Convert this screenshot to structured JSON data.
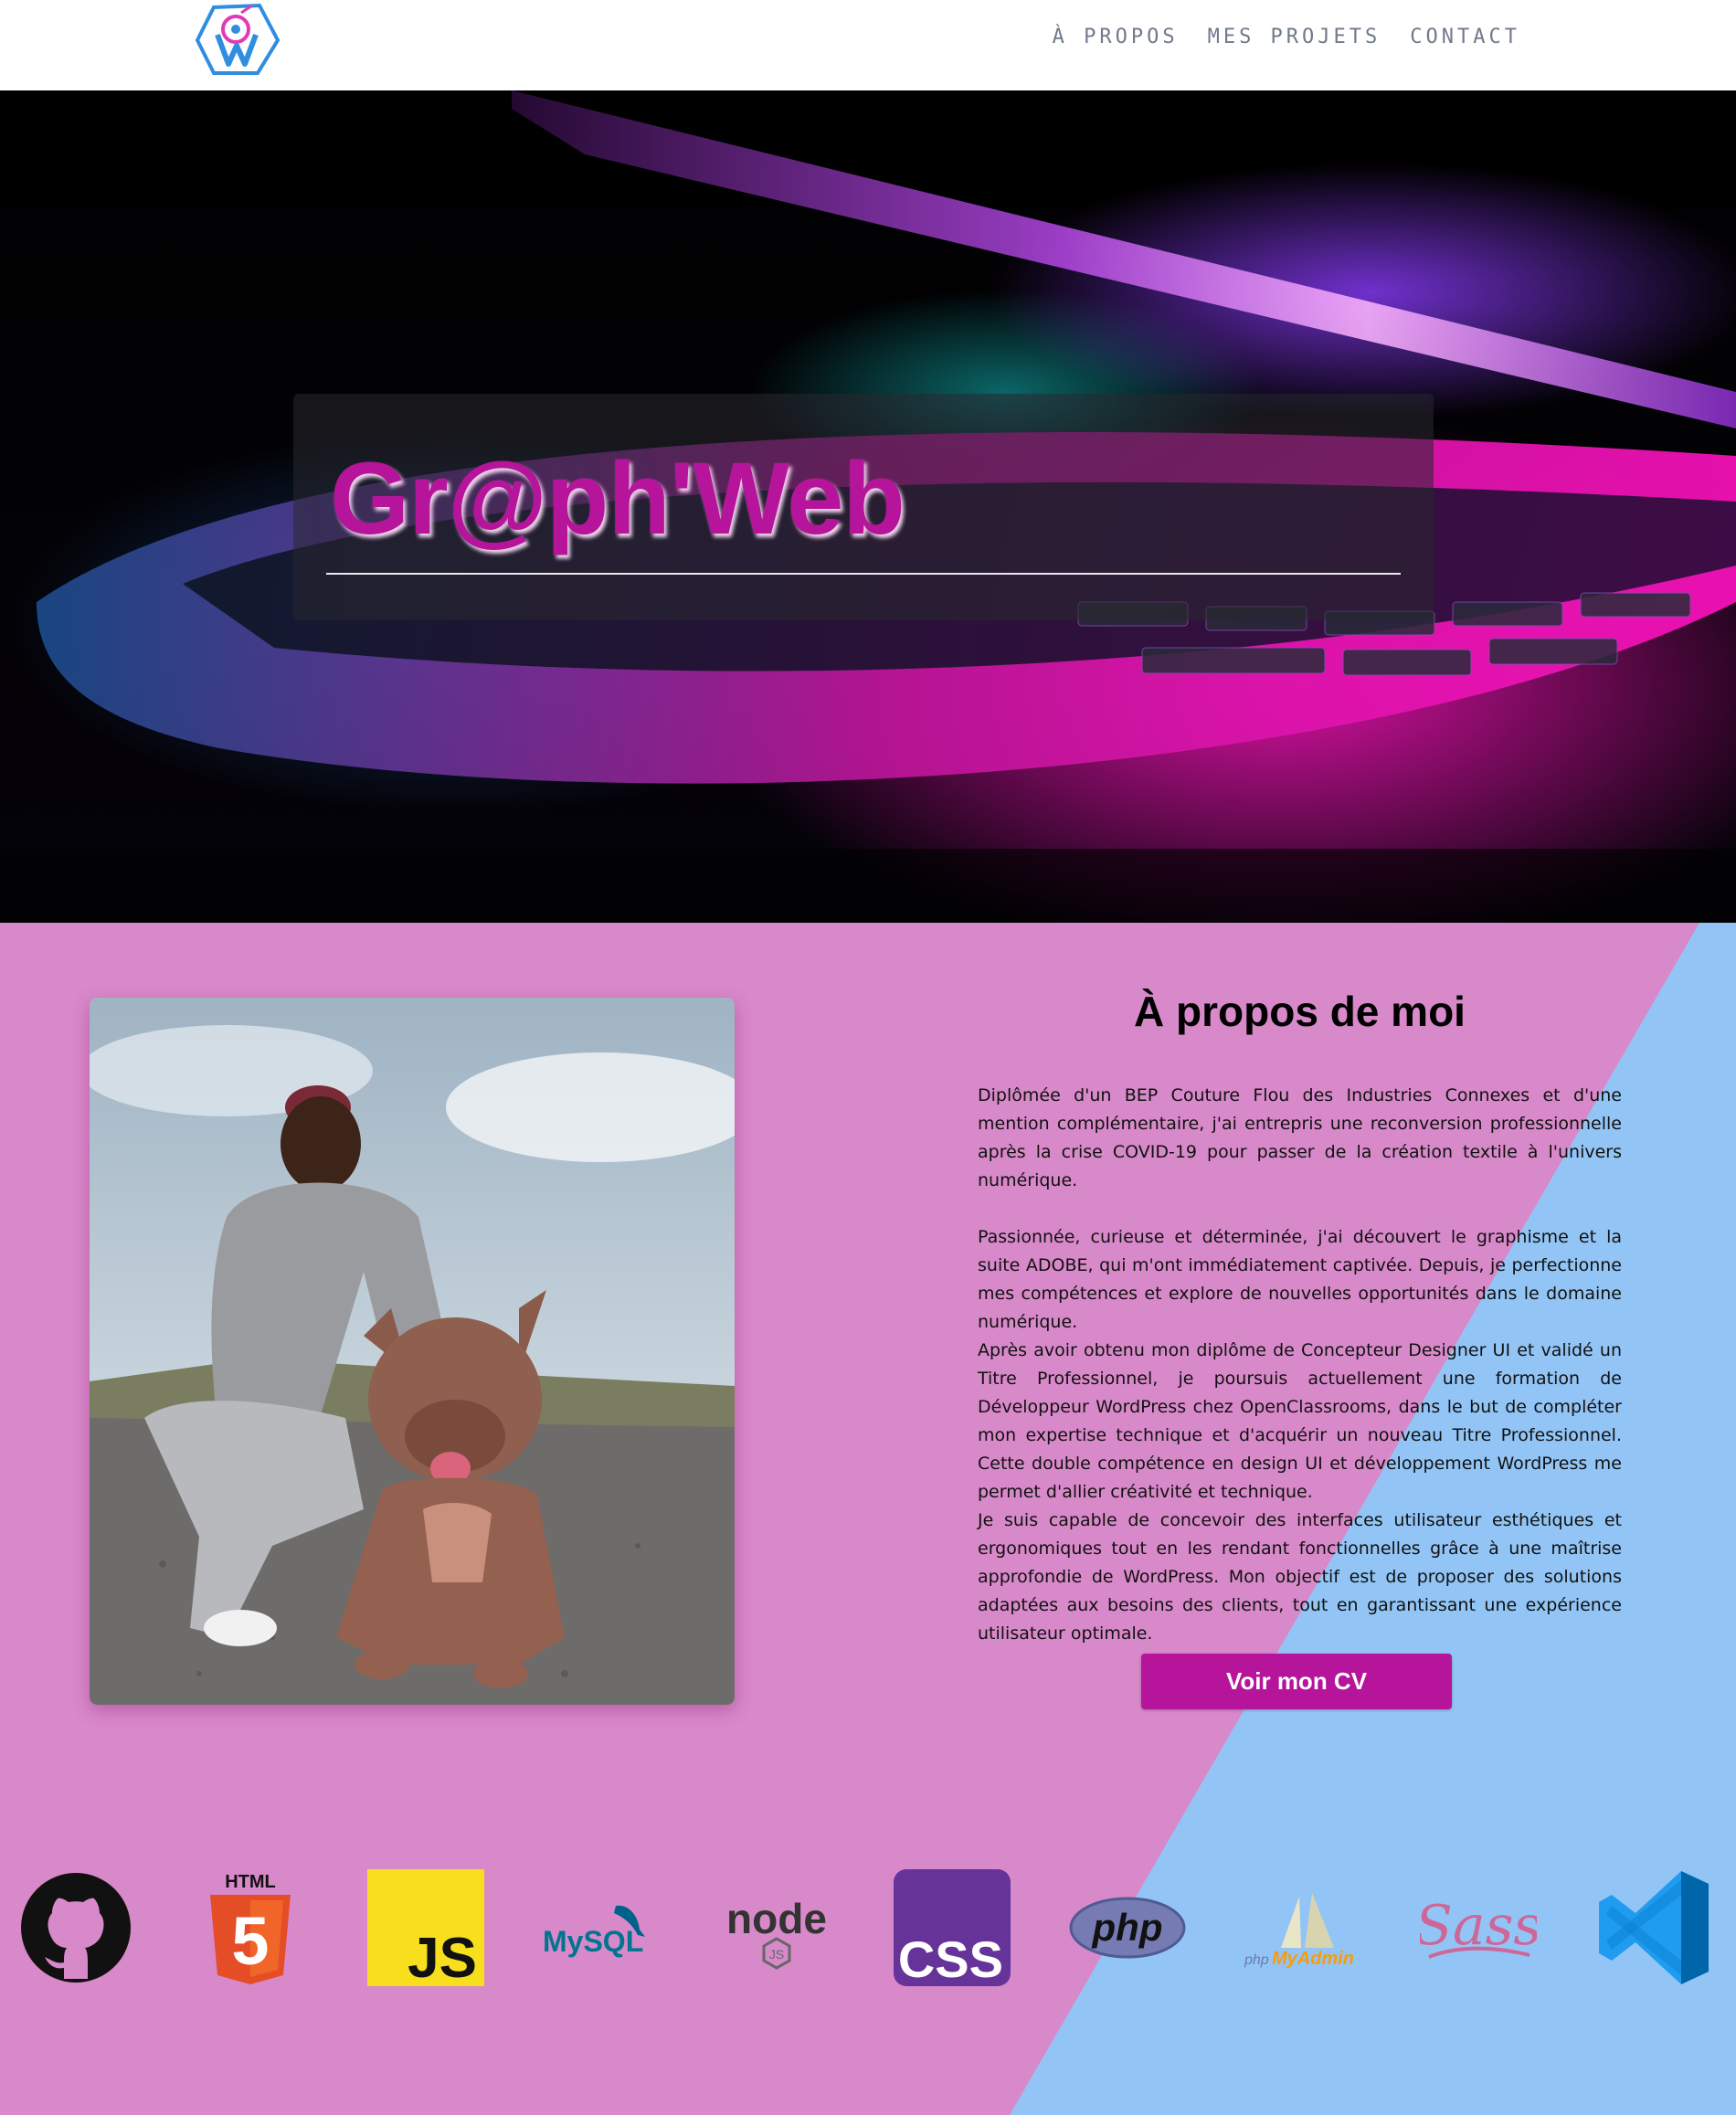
{
  "header": {
    "logo_alt": "Gr@ph'Web logo",
    "nav": [
      {
        "label": "À PROPOS"
      },
      {
        "label": "MES PROJETS"
      },
      {
        "label": "CONTACT"
      }
    ]
  },
  "hero": {
    "title": "Gr@ph'Web"
  },
  "about": {
    "title": "À propos de moi",
    "paragraphs": [
      "Diplômée d'un BEP Couture Flou des Industries Connexes et d'une mention complémentaire, j'ai entrepris une reconversion professionnelle après la crise COVID-19 pour passer de la création textile à l'univers numérique.",
      "Passionnée, curieuse et déterminée, j'ai découvert le graphisme et la suite ADOBE, qui m'ont immédiatement captivée. Depuis, je perfectionne mes compétences et explore de nouvelles opportunités dans le domaine numérique.",
      "Après avoir obtenu mon diplôme de Concepteur Designer UI et validé un Titre Professionnel, je poursuis actuellement une formation de Développeur WordPress chez OpenClassrooms, dans le but de compléter mon expertise technique et d'acquérir un nouveau Titre Professionnel. Cette double compétence en design UI et développement WordPress me permet d'allier créativité et technique.",
      "Je suis capable de concevoir des interfaces utilisateur esthétiques et ergonomiques tout en les rendant fonctionnelles grâce à une maîtrise approfondie de WordPress. Mon objectif est de proposer des solutions adaptées aux besoins des clients, tout en garantissant une expérience utilisateur optimale."
    ],
    "cv_button": "Voir mon CV"
  },
  "tech_logos": {
    "html_label": "HTML",
    "html_number": "5",
    "js_label": "JS",
    "mysql_label": "MySQL",
    "node_label": "node",
    "node_sub": "JS",
    "css_label": "CSS",
    "php_label": "php",
    "phpmyadmin_prefix": "php",
    "phpmyadmin_label": "MyAdmin",
    "sass_label": "Sass"
  },
  "colors": {
    "accent": "#b5149b",
    "about_pink": "#d889c9",
    "about_blue": "#92c5f5",
    "nav_text": "#6f7a8a"
  }
}
